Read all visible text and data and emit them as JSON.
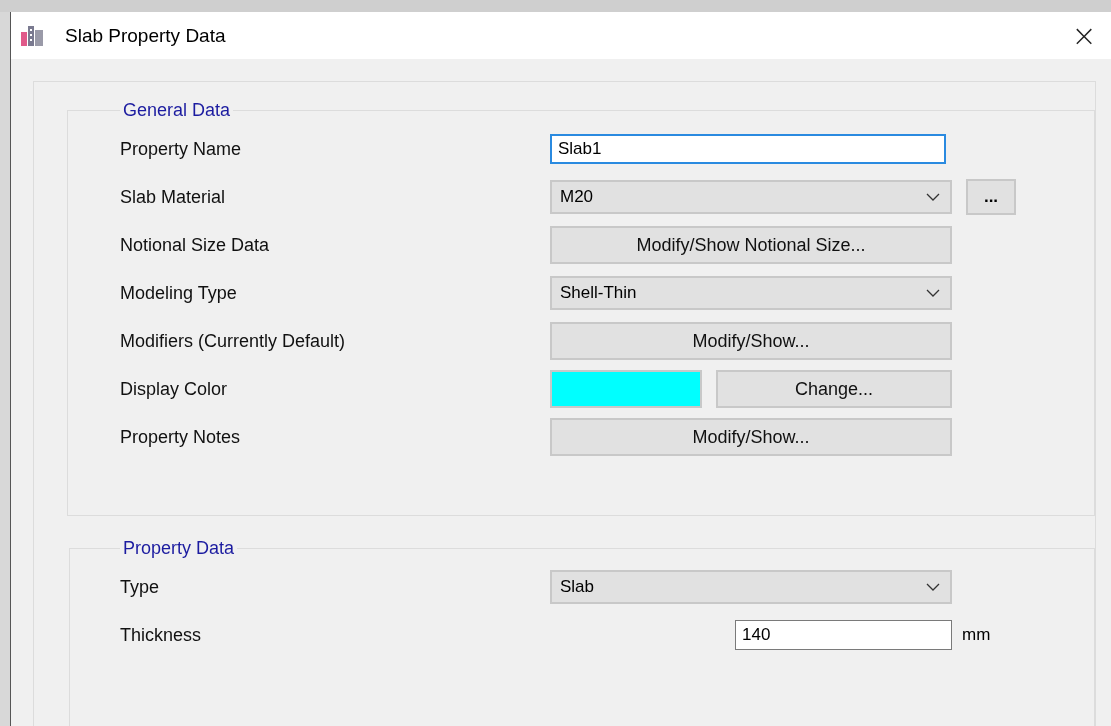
{
  "window": {
    "title": "Slab Property Data",
    "close": "×"
  },
  "general_data": {
    "title": "General Data",
    "rows": [
      {
        "kind": "text",
        "label": "Property Name",
        "value": "Slab1",
        "focused": true
      },
      {
        "kind": "combo",
        "label": "Slab Material",
        "value": "M20",
        "extra_button": "..."
      },
      {
        "kind": "button",
        "label": "Notional Size Data",
        "button": "Modify/Show Notional Size..."
      },
      {
        "kind": "combo",
        "label": "Modeling Type",
        "value": "Shell-Thin"
      },
      {
        "kind": "button",
        "label": "Modifiers (Currently Default)",
        "button": "Modify/Show..."
      },
      {
        "kind": "color",
        "label": "Display Color",
        "color": "#00ffff",
        "button": "Change..."
      },
      {
        "kind": "button",
        "label": "Property Notes",
        "button": "Modify/Show..."
      }
    ]
  },
  "property_data": {
    "title": "Property Data",
    "rows": [
      {
        "kind": "combo",
        "label": "Type",
        "value": "Slab"
      },
      {
        "kind": "number",
        "label": "Thickness",
        "value": "140",
        "unit": "mm",
        "focused": false
      }
    ]
  }
}
